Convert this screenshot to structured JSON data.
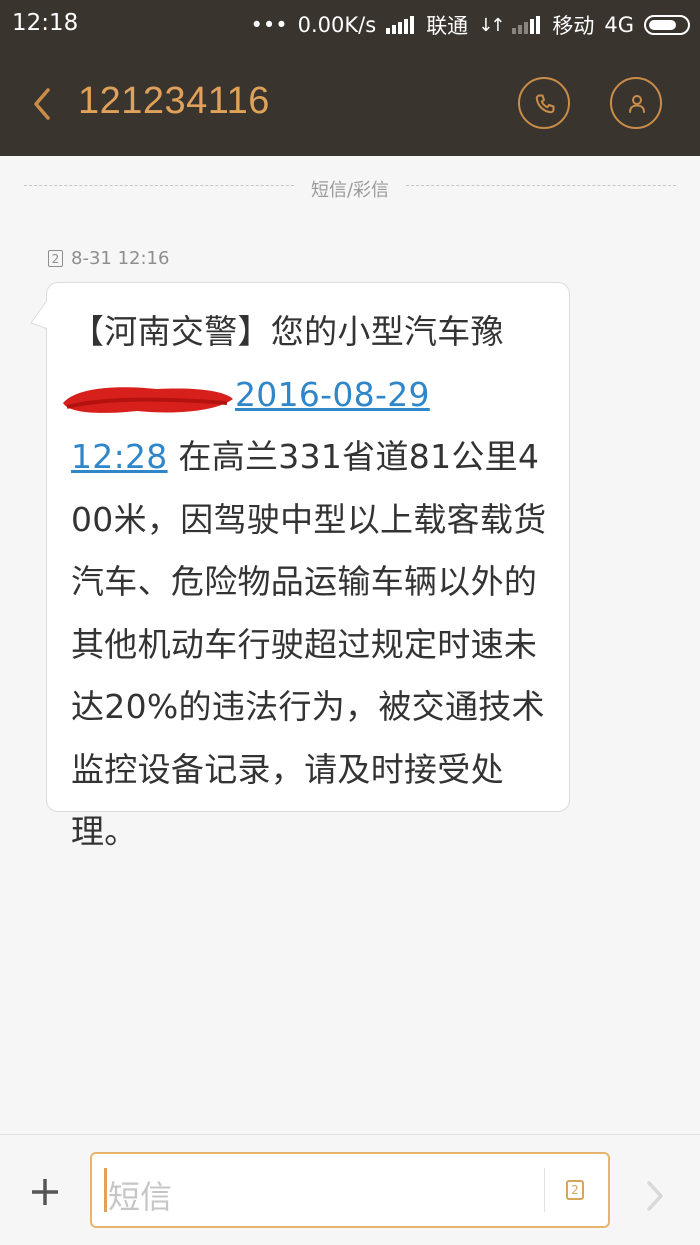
{
  "status_bar": {
    "time": "12:18",
    "dots": "•••",
    "speed": "0.00K/s",
    "carrier1": "联通",
    "carrier2": "移动",
    "network": "4G"
  },
  "header": {
    "title": "121234116",
    "accent_color": "#e0a25a",
    "background": "#3a342f"
  },
  "divider_label": "短信/彩信",
  "message": {
    "sim": "2",
    "timestamp": "8-31 12:16",
    "text_part1": "【河南交警】您的小型汽车豫",
    "link_part1": "2016-08-29",
    "link_part2": "12:28",
    "text_part2": " 在高兰331省道81公里400米，因驾驶中型以上载客载货汽车、危险物品运输车辆以外的其他机动车行驶超过规定时速未达20%的违法行为，被交通技术监控设备记录，请及时接受处理。"
  },
  "composer": {
    "placeholder": "短信",
    "sim": "2"
  }
}
